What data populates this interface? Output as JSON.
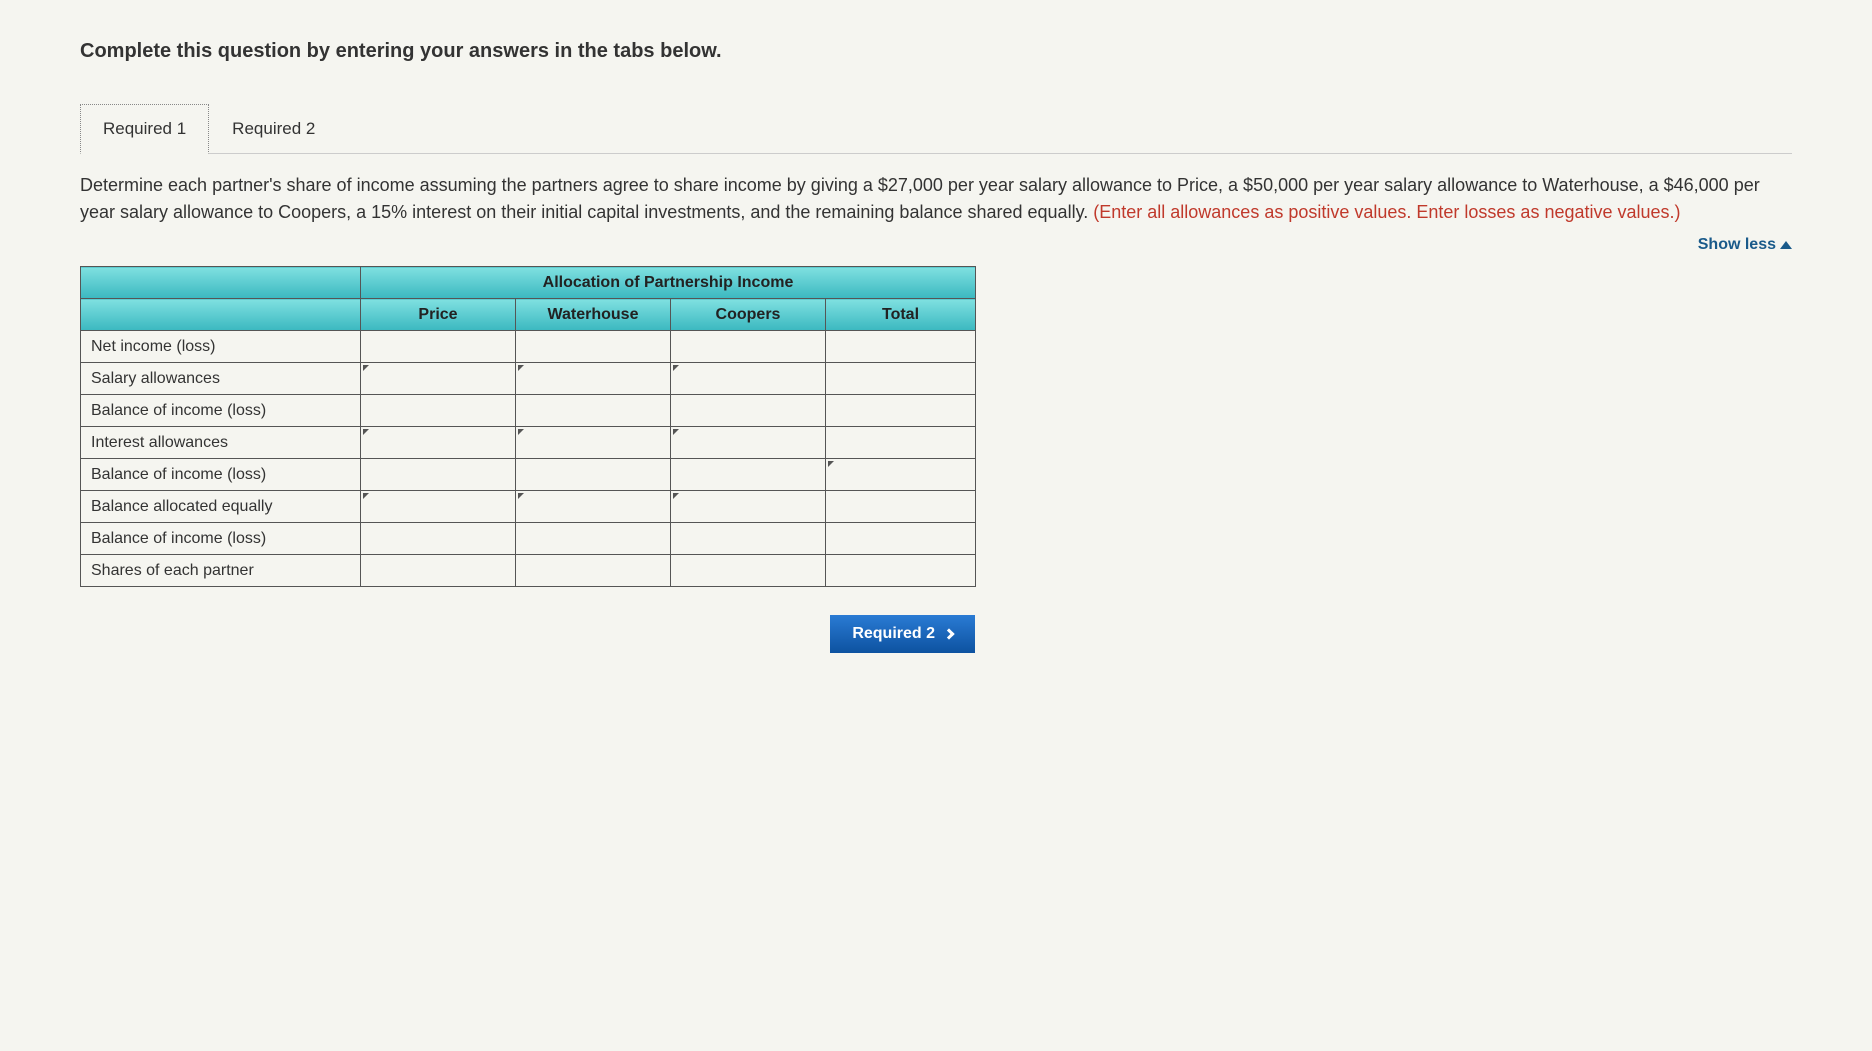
{
  "instruction": "Complete this question by entering your answers in the tabs below.",
  "tabs": [
    {
      "label": "Required 1",
      "active": true
    },
    {
      "label": "Required 2",
      "active": false
    }
  ],
  "question": {
    "main": "Determine each partner's share of income assuming the partners agree to share income by giving a $27,000 per year salary allowance to Price, a $50,000 per year salary allowance to Waterhouse, a $46,000 per year salary allowance to Coopers, a 15% interest on their initial capital investments, and the remaining balance shared equally. ",
    "hint": "(Enter all allowances as positive values. Enter losses as negative values.)"
  },
  "show_less": "Show less",
  "table": {
    "title": "Allocation of Partnership Income",
    "columns": [
      "Price",
      "Waterhouse",
      "Coopers",
      "Total"
    ],
    "rows": [
      {
        "label": "Net income (loss)",
        "editable": [
          false,
          false,
          false,
          true
        ],
        "caret": [
          false,
          false,
          false,
          false
        ]
      },
      {
        "label": "Salary allowances",
        "editable": [
          true,
          true,
          true,
          true
        ],
        "caret": [
          true,
          true,
          true,
          false
        ]
      },
      {
        "label": "Balance of income (loss)",
        "editable": [
          false,
          false,
          false,
          true
        ],
        "caret": [
          false,
          false,
          false,
          false
        ]
      },
      {
        "label": "Interest allowances",
        "editable": [
          true,
          true,
          true,
          true
        ],
        "caret": [
          true,
          true,
          true,
          false
        ]
      },
      {
        "label": "Balance of income (loss)",
        "editable": [
          false,
          false,
          false,
          true
        ],
        "caret": [
          false,
          false,
          false,
          true
        ]
      },
      {
        "label": "Balance allocated equally",
        "editable": [
          true,
          true,
          true,
          true
        ],
        "caret": [
          true,
          true,
          true,
          false
        ]
      },
      {
        "label": "Balance of income (loss)",
        "editable": [
          false,
          false,
          false,
          true
        ],
        "caret": [
          false,
          false,
          false,
          false
        ]
      },
      {
        "label": "Shares of each partner",
        "editable": [
          true,
          true,
          true,
          true
        ],
        "caret": [
          false,
          false,
          false,
          false
        ]
      }
    ]
  },
  "next_button": "Required 2"
}
